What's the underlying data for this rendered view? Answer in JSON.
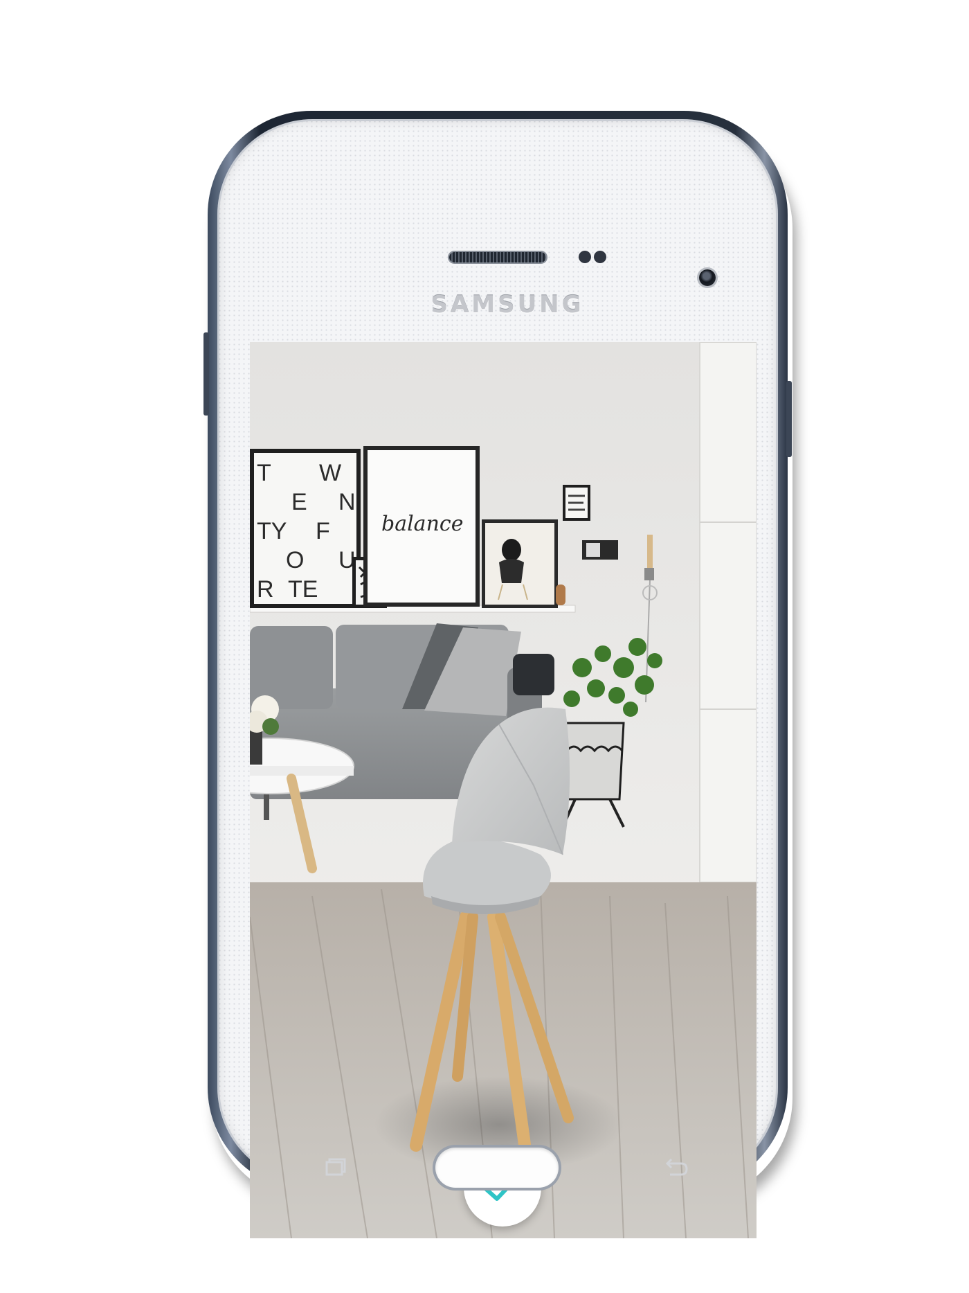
{
  "device": {
    "brand_label": "SAMSUNG",
    "frame_color": "#2a3444",
    "bezel_color": "#f4f5f7"
  },
  "ar_scene": {
    "posters": {
      "typography_letters": [
        "T",
        "W",
        "E",
        "N",
        "TY",
        "F",
        "O",
        "U",
        "R",
        "TE",
        "E",
        "N"
      ],
      "balance_script": "balance"
    },
    "placed_object": "chair"
  },
  "controls": {
    "confirm_icon": "checkmark-icon",
    "confirm_color": "#2ec4c6",
    "home_button_icon": "home-button",
    "recent_apps_icon": "recent-apps-icon",
    "back_icon": "back-icon"
  }
}
